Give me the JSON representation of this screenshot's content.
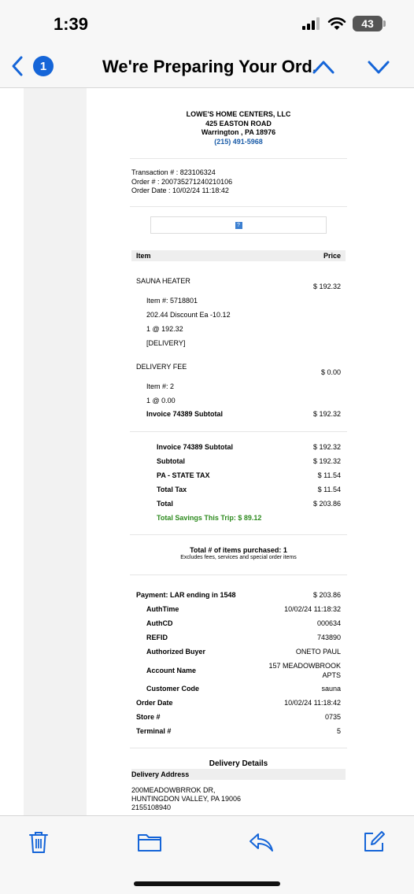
{
  "status_bar": {
    "time": "1:39",
    "battery": "43"
  },
  "nav": {
    "badge_count": "1",
    "title": "We're Preparing Your Ord..."
  },
  "store": {
    "name": "LOWE'S HOME CENTERS, LLC",
    "address": "425 EASTON ROAD",
    "city": "Warrington , PA 18976",
    "phone": "(215) 491-5968"
  },
  "transaction": {
    "transaction_line": "Transaction # : 823106324",
    "order_line": "Order # : 200735271240210106",
    "date_line": "Order Date : 10/02/24 11:18:42"
  },
  "image_placeholder": "?",
  "table": {
    "item_header": "Item",
    "price_header": "Price"
  },
  "items": [
    {
      "name": "SAUNA HEATER",
      "price": "$ 192.32",
      "details": [
        "Item #: 5718801",
        "202.44 Discount Ea -10.12",
        "1 @ 192.32",
        "[DELIVERY]"
      ]
    },
    {
      "name": "DELIVERY FEE",
      "price": "$ 0.00",
      "details": [
        "Item #: 2",
        "1 @ 0.00"
      ]
    }
  ],
  "invoice_subtotal": {
    "label": "Invoice 74389 Subtotal",
    "value": "$ 192.32"
  },
  "totals": [
    {
      "label": "Invoice 74389 Subtotal",
      "value": "$ 192.32"
    },
    {
      "label": "Subtotal",
      "value": "$ 192.32"
    },
    {
      "label": "PA - STATE TAX",
      "value": "$ 11.54"
    },
    {
      "label": "Total Tax",
      "value": "$ 11.54"
    },
    {
      "label": "Total",
      "value": "$ 203.86"
    }
  ],
  "savings": "Total Savings This Trip: $ 89.12",
  "items_count": {
    "label": "Total # of items purchased: 1",
    "note": "Excludes fees, services and special order items"
  },
  "payment": {
    "label": "Payment: LAR ending in 1548",
    "value": "$ 203.86",
    "rows": [
      {
        "label": "AuthTime",
        "value": "10/02/24 11:18:32"
      },
      {
        "label": "AuthCD",
        "value": "000634"
      },
      {
        "label": "REFID",
        "value": "743890"
      },
      {
        "label": "Authorized Buyer",
        "value": "ONETO PAUL"
      },
      {
        "label": "Account Name",
        "value_line1": "157 MEADOWBROOK",
        "value_line2": "APTS"
      },
      {
        "label": "Customer Code",
        "value": "sauna"
      }
    ],
    "order_date": {
      "label": "Order Date",
      "value": "10/02/24 11:18:42"
    },
    "store": {
      "label": "Store #",
      "value": "0735"
    },
    "terminal": {
      "label": "Terminal #",
      "value": "5"
    }
  },
  "delivery": {
    "title": "Delivery Details",
    "address_header": "Delivery Address",
    "lines": [
      "200MEADOWBRROK DR,",
      "HUNTINGDON VALLEY, PA 19006",
      "2155108940"
    ]
  },
  "toolbar": {
    "icons": [
      "trash-icon",
      "folder-icon",
      "reply-icon",
      "compose-icon"
    ],
    "accent": "#1565d8"
  }
}
